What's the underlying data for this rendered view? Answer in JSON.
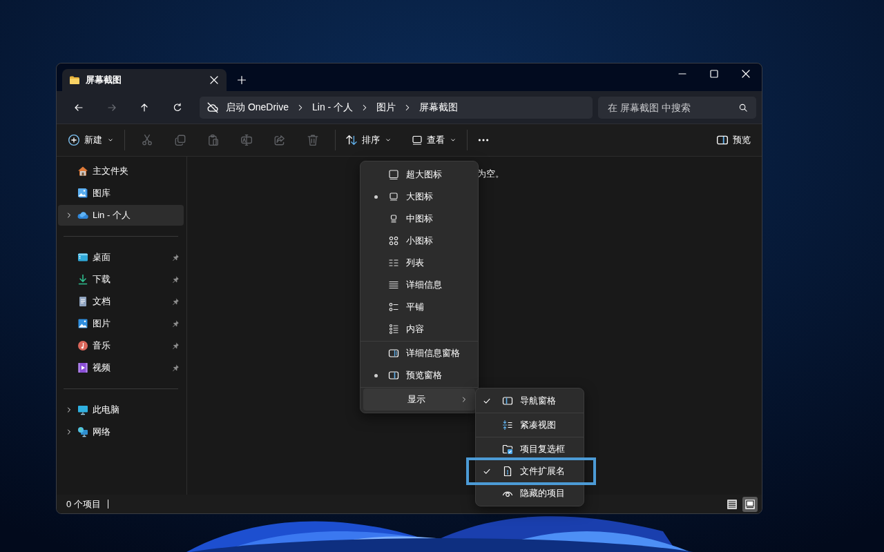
{
  "tabs": [
    {
      "title": "屏幕截图",
      "selected": true
    }
  ],
  "address_bar": {
    "segments": [
      "启动 OneDrive",
      "Lin - 个人",
      "图片",
      "屏幕截图"
    ]
  },
  "navigation": [
    {
      "kind": "back",
      "disabled": false
    },
    {
      "kind": "forward",
      "disabled": true
    },
    {
      "kind": "up",
      "disabled": false
    },
    {
      "kind": "refresh",
      "disabled": false
    }
  ],
  "search": {
    "placeholder": "在 屏幕截图 中搜索"
  },
  "toolbar": {
    "new_label": "新建",
    "tools": [
      {
        "kind": "cut",
        "disabled": true
      },
      {
        "kind": "copy",
        "disabled": true
      },
      {
        "kind": "paste",
        "disabled": true
      },
      {
        "kind": "rename",
        "disabled": true
      },
      {
        "kind": "share",
        "disabled": true
      },
      {
        "kind": "delete",
        "disabled": true
      }
    ],
    "sort_label": "排序",
    "view_label": "查看",
    "preview_label": "预览"
  },
  "sidebar": {
    "groups": [
      [
        {
          "label": "主文件夹",
          "kind": "home",
          "expandable": false,
          "pinned": false,
          "selected": false
        },
        {
          "label": "图库",
          "kind": "gallery",
          "expandable": false,
          "pinned": false,
          "selected": false
        },
        {
          "label": "Lin - 个人",
          "kind": "cloud",
          "expandable": true,
          "pinned": false,
          "selected": true
        }
      ],
      [
        {
          "label": "桌面",
          "kind": "desktop",
          "expandable": false,
          "pinned": true,
          "selected": false
        },
        {
          "label": "下载",
          "kind": "download",
          "expandable": false,
          "pinned": true,
          "selected": false
        },
        {
          "label": "文档",
          "kind": "document",
          "expandable": false,
          "pinned": true,
          "selected": false
        },
        {
          "label": "图片",
          "kind": "pictures",
          "expandable": false,
          "pinned": true,
          "selected": false
        },
        {
          "label": "音乐",
          "kind": "music",
          "expandable": false,
          "pinned": true,
          "selected": false
        },
        {
          "label": "视频",
          "kind": "video",
          "expandable": false,
          "pinned": true,
          "selected": false
        }
      ],
      [
        {
          "label": "此电脑",
          "kind": "pc",
          "expandable": true,
          "pinned": false,
          "selected": false
        },
        {
          "label": "网络",
          "kind": "network",
          "expandable": true,
          "pinned": false,
          "selected": false
        }
      ]
    ]
  },
  "content": {
    "empty_message": "为空。"
  },
  "view_menu": {
    "sections": [
      [
        {
          "label": "超大图标",
          "kind": "xl",
          "selected": false
        },
        {
          "label": "大图标",
          "kind": "large",
          "selected": true
        },
        {
          "label": "中图标",
          "kind": "medium",
          "selected": false
        },
        {
          "label": "小图标",
          "kind": "small",
          "selected": false
        },
        {
          "label": "列表",
          "kind": "list",
          "selected": false
        },
        {
          "label": "详细信息",
          "kind": "details",
          "selected": false
        },
        {
          "label": "平铺",
          "kind": "tiles",
          "selected": false
        },
        {
          "label": "内容",
          "kind": "content",
          "selected": false
        }
      ],
      [
        {
          "label": "详细信息窗格",
          "kind": "details-pane",
          "selected": false
        },
        {
          "label": "预览窗格",
          "kind": "preview-pane",
          "selected": true
        }
      ]
    ],
    "show_item": {
      "label": "显示",
      "expanded": true
    },
    "submenu": [
      {
        "label": "导航窗格",
        "kind": "nav-pane",
        "checked": true,
        "highlighted": false
      },
      {
        "label": "紧凑视图",
        "kind": "compact",
        "checked": false,
        "highlighted": false
      },
      {
        "label": "项目复选框",
        "kind": "item-checkbox",
        "checked": false,
        "highlighted": false
      },
      {
        "label": "文件扩展名",
        "kind": "file-ext",
        "checked": true,
        "highlighted": true
      },
      {
        "label": "隐藏的项目",
        "kind": "eye",
        "checked": false,
        "highlighted": false
      }
    ]
  },
  "status_bar": {
    "count": "0 个项目",
    "view_buttons": [
      {
        "kind": "details",
        "selected": false
      },
      {
        "kind": "tiles",
        "selected": true
      }
    ]
  }
}
